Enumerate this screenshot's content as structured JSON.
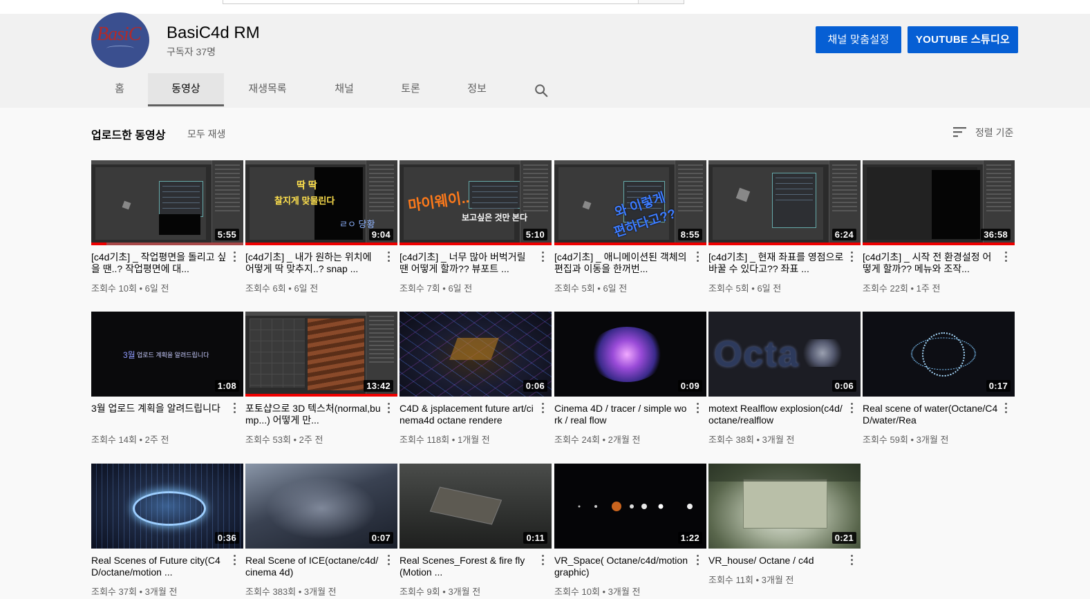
{
  "channel": {
    "name": "BasiC4d RM",
    "subscribers": "구독자 37명",
    "avatar_text": "BasiC",
    "customize_label": "채널 맞춤설정",
    "studio_label": "YOUTUBE 스튜디오"
  },
  "tabs": [
    "홈",
    "동영상",
    "재생목록",
    "채널",
    "토론",
    "정보"
  ],
  "active_tab": "동영상",
  "section": {
    "title": "업로드한 동영상",
    "play_all": "모두 재생",
    "sort_label": "정렬 기준"
  },
  "videos": [
    {
      "title": "[c4d기초] _ 작업평면을 돌리고 싶을 땐..? 작업평면에 대...",
      "meta": "조회수 10회 • 6일 전",
      "duration": "5:55",
      "watched": 0.1
    },
    {
      "title": "[c4d기초] _ 내가 원하는 위치에 어떻게 딱 맞추지..? snap ...",
      "meta": "조회수 6회 • 6일 전",
      "duration": "9:04",
      "watched": 1.0,
      "overlay": [
        "딱 딱",
        "찰지게 맞물린다",
        "ㄹㅇ 당황"
      ]
    },
    {
      "title": "[c4d기초] _ 너무 많아 버벅거릴 땐 어떻게 할까?? 뷰포트 ...",
      "meta": "조회수 7회 • 6일 전",
      "duration": "5:10",
      "watched": 1.0,
      "overlay": [
        "마이웨이..",
        "보고싶은 것만 본다"
      ]
    },
    {
      "title": "[c4d기초] _ 애니메이션된 객체의 편집과 이동을 한꺼번...",
      "meta": "조회수 5회 • 6일 전",
      "duration": "8:55",
      "watched": 1.0,
      "overlay": [
        "와 이렇게",
        "편하다고??"
      ]
    },
    {
      "title": "[c4d기초] _ 현재 좌표를 영점으로 바꿀 수 있다고?? 좌표 ...",
      "meta": "조회수 5회 • 6일 전",
      "duration": "6:24",
      "watched": 1.0
    },
    {
      "title": "[c4d기초] _ 시작 전 환경설정 어떻게 할까?? 메뉴와 조작...",
      "meta": "조회수 22회 • 1주 전",
      "duration": "36:58",
      "watched": 1.0
    },
    {
      "title": "3월 업로드 계획을 알려드립니다",
      "meta": "조회수 14회 • 2주 전",
      "duration": "1:08",
      "overlay": [
        "3월",
        "업로드 계획을 알려드립니다"
      ]
    },
    {
      "title": "포토샵으로 3D 텍스처(normal,bump...) 어떻게 만...",
      "meta": "조회수 53회 • 2주 전",
      "duration": "13:42",
      "watched": 1.0
    },
    {
      "title": "C4D & jsplacement future art/cinema4d octane rendere",
      "meta": "조회수 118회 • 1개월 전",
      "duration": "0:06"
    },
    {
      "title": "Cinema 4D / tracer / simple work / real flow",
      "meta": "조회수 24회 • 2개월 전",
      "duration": "0:09"
    },
    {
      "title": "motext Realflow explosion(c4d/octane/realflow",
      "meta": "조회수 38회 • 3개월 전",
      "duration": "0:06"
    },
    {
      "title": "Real scene of water(Octane/C4D/water/Rea",
      "meta": "조회수 59회 • 3개월 전",
      "duration": "0:17"
    },
    {
      "title": "Real Scenes of Future city(C4D/octane/motion ...",
      "meta": "조회수 37회 • 3개월 전",
      "duration": "0:36"
    },
    {
      "title": "Real Scene of ICE(octane/c4d/cinema 4d)",
      "meta": "조회수 383회 • 3개월 전",
      "duration": "0:07"
    },
    {
      "title": "Real Scenes_Forest & fire fly(Motion ...",
      "meta": "조회수 9회 • 3개월 전",
      "duration": "0:11"
    },
    {
      "title": "VR_Space( Octane/c4d/motion graphic)",
      "meta": "조회수 10회 • 3개월 전",
      "duration": "1:22"
    },
    {
      "title": "VR_house/ Octane / c4d",
      "meta": "조회수 11회 • 3개월 전",
      "duration": "0:21"
    }
  ],
  "colors": {
    "accent": "#065fd4",
    "progress": "#ff0000",
    "text_secondary": "#606060"
  }
}
